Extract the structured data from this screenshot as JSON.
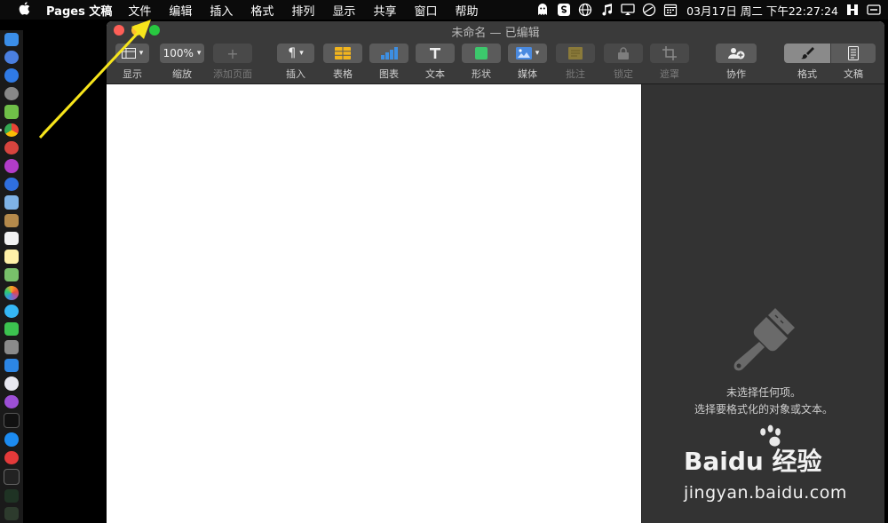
{
  "menubar": {
    "app_name": "Pages 文稿",
    "items": [
      "文件",
      "编辑",
      "插入",
      "格式",
      "排列",
      "显示",
      "共享",
      "窗口",
      "帮助"
    ],
    "clock": "03月17日 周二 下午22:27:24",
    "status_icons": [
      "ghost-icon",
      "s-icon",
      "globe-icon",
      "music-icon",
      "display-icon",
      "timer-icon",
      "calendar-icon",
      "wiki-icon",
      "switch-icon"
    ]
  },
  "window": {
    "title": "未命名 — 已编辑",
    "zoom_value": "100%"
  },
  "toolbar": {
    "view": "显示",
    "zoom": "缩放",
    "add_page": "添加页面",
    "insert": "插入",
    "table": "表格",
    "chart": "图表",
    "text": "文本",
    "shape": "形状",
    "media": "媒体",
    "comment": "批注",
    "lock": "锁定",
    "mask": "遮罩",
    "collaborate": "协作",
    "format": "格式",
    "document": "文稿"
  },
  "inspector": {
    "empty_line1": "未选择任何项。",
    "empty_line2": "选择要格式化的对象或文本。"
  },
  "watermark": {
    "logo_text": "Baidu 经验",
    "url": "jingyan.baidu.com"
  },
  "colors": {
    "accent_arrow": "#f7e51c",
    "traffic_close": "#fe5f57",
    "traffic_min": "#febc2e",
    "traffic_zoom": "#28c840"
  }
}
